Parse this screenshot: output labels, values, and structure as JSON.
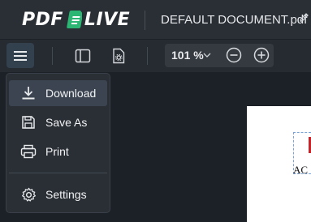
{
  "app": {
    "logo_left": "PDF",
    "logo_right": "LIVE",
    "document_name": "DEFAULT DOCUMENT.pdf"
  },
  "toolbar": {
    "zoom_value": "101 %"
  },
  "menu": {
    "items": [
      {
        "label": "Download",
        "icon": "download-icon"
      },
      {
        "label": "Save As",
        "icon": "save-icon"
      },
      {
        "label": "Print",
        "icon": "print-icon"
      },
      {
        "label": "Settings",
        "icon": "gear-icon"
      }
    ]
  },
  "document": {
    "visible_text": "AC"
  },
  "colors": {
    "accent_green": "#2bb673",
    "background": "#1c2127",
    "topbar": "#2a2f36"
  }
}
